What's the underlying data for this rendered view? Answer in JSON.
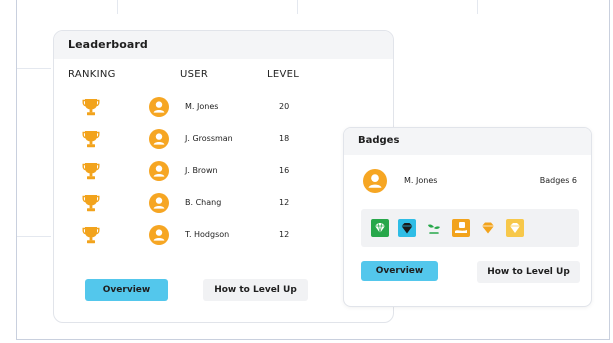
{
  "leaderboard": {
    "title": "Leaderboard",
    "columns": {
      "ranking": "RANKING",
      "user": "USER",
      "level": "LEVEL"
    },
    "rows": [
      {
        "name": "M. Jones",
        "level": "20"
      },
      {
        "name": "J. Grossman",
        "level": "18"
      },
      {
        "name": "J. Brown",
        "level": "16"
      },
      {
        "name": "B. Chang",
        "level": "12"
      },
      {
        "name": "T. Hodgson",
        "level": "12"
      }
    ],
    "overview_label": "Overview",
    "level_up_label": "How to Level Up"
  },
  "badges": {
    "title": "Badges",
    "user_name": "M. Jones",
    "count_label": "Badges 6",
    "items": [
      "diamond-green-icon",
      "diamond-blue-icon",
      "plant-icon",
      "hand-gift-icon",
      "gem-gold-icon",
      "diamond-gold-icon"
    ],
    "overview_label": "Overview",
    "level_up_label": "How to Level Up"
  },
  "colors": {
    "accent": "#53c7ec",
    "avatar": "#f6a623",
    "trophy": "#f2a31c"
  }
}
